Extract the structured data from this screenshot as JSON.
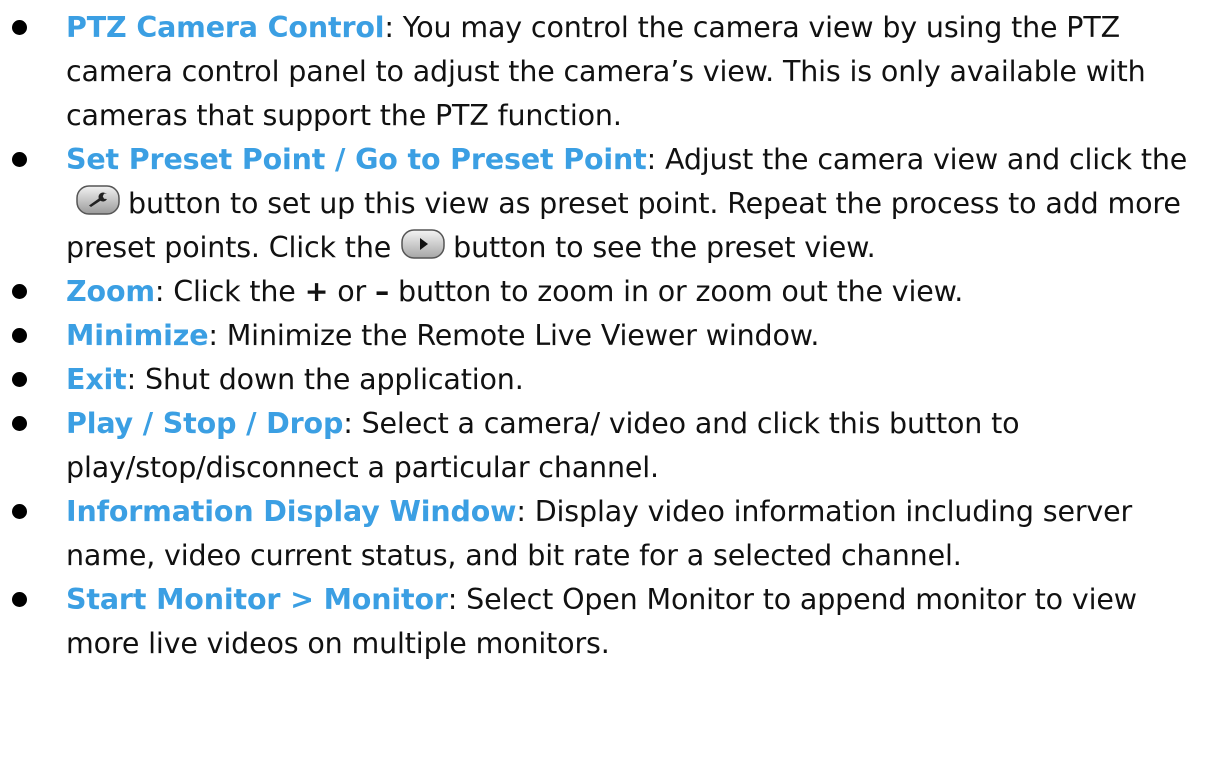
{
  "items": [
    {
      "term": "PTZ Camera Control",
      "text": ": You may control the camera view by using the PTZ camera control panel to adjust the camera’s view. This is only available with cameras that support the PTZ function."
    },
    {
      "term": "Set Preset Point / Go to Preset Point",
      "text_a": ": Adjust the camera view and click the",
      "icon_a": "set-preset-wrench-icon",
      "text_b": "button to set up this view as preset point. Repeat the process to add more preset points. Click the",
      "icon_b": "go-to-preset-play-icon",
      "text_c": "button to see the preset view."
    },
    {
      "term": "Zoom",
      "text_a": ": Click the ",
      "plus": "+",
      "text_b": " or ",
      "minus": "–",
      "text_c": " button to zoom in or zoom out the view."
    },
    {
      "term": "Minimize",
      "text": ": Minimize the Remote Live Viewer window."
    },
    {
      "term": "Exit",
      "text": ": Shut down the application."
    },
    {
      "term": "Play / Stop / Drop",
      "text": ": Select a camera/ video and click this button to play/stop/disconnect a particular channel."
    },
    {
      "term": "Information Display Window",
      "text": ": Display video information including server name, video current status, and bit rate for a selected channel."
    },
    {
      "term": "Start Monitor > Monitor",
      "text": ": Select Open Monitor to append monitor to view more live videos on multiple monitors."
    }
  ],
  "colors": {
    "term": "#3b9fe3",
    "body_text": "#111111",
    "bullet": "#000000"
  }
}
